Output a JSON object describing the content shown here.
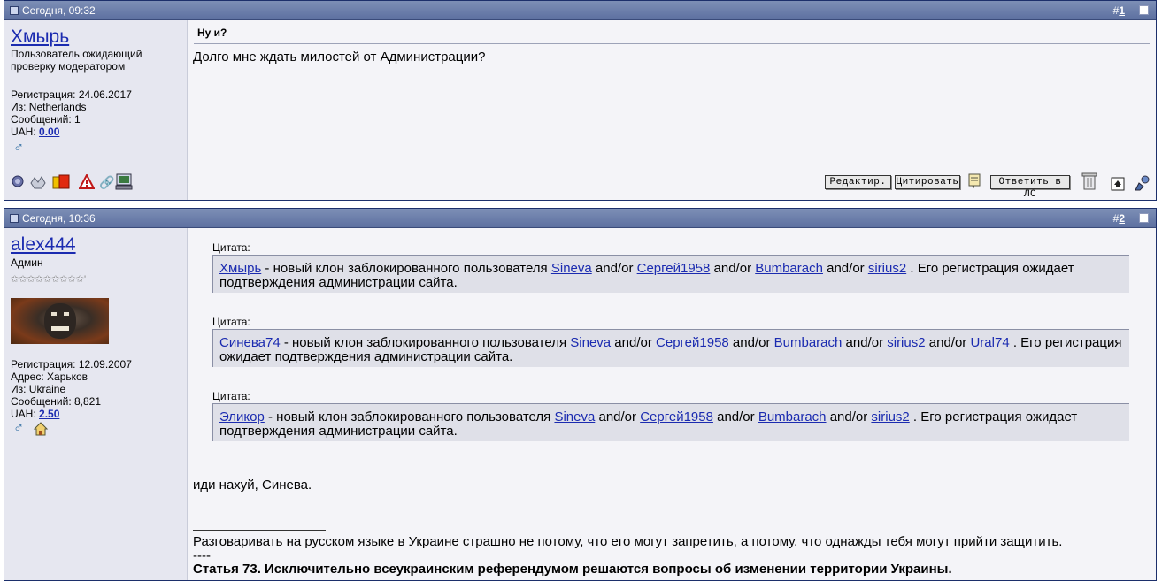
{
  "post1": {
    "date": "Сегодня, 09:32",
    "number_prefix": "#",
    "number": "1",
    "username": "Хмырь",
    "status": "Пользователь ожидающий проверку модератором",
    "reg": "Регистрация: 24.06.2017",
    "from": "Из: Netherlands",
    "posts": "Сообщений: 1",
    "uah_label": "UAH: ",
    "uah_value": "0.00",
    "title": "Ну и?",
    "message": "Долго мне ждать милостей от Администрации?",
    "buttons": {
      "edit": "Редактир.",
      "quote": "Цитировать",
      "reply_pm": "Ответить в ЛС"
    },
    "icons": [
      "offline-icon",
      "reputation-icon",
      "warning-card-icon",
      "report-icon",
      "attach-icon",
      "ip-icon",
      "note-icon",
      "delete-icon",
      "quick-reply-icon",
      "multi-quote-icon"
    ]
  },
  "post2": {
    "date": "Сегодня, 10:36",
    "number_prefix": "#",
    "number": "2",
    "username": "alex444",
    "role": "Админ",
    "stars": "✩✩✩✩✩✩✩✩✩'",
    "reg": "Регистрация: 12.09.2007",
    "address": "Адрес: Харьков",
    "from": "Из: Ukraine",
    "posts": "Сообщений: 8,821",
    "uah_label": "UAH: ",
    "uah_value": "2.50",
    "quote_label": "Цитата:",
    "quotes": [
      {
        "lead": "Хмырь",
        "text1": " - новый клон заблокированного пользователя ",
        "l1": "Sineva",
        "and": " and/or ",
        "l2": "Сергей1958",
        "l3": "Bumbarach",
        "l4": "sirius2",
        "tail": " . Его регистрация ожидает",
        "line2": "подтверждения администрации сайта."
      },
      {
        "lead": "Синева74",
        "text1": " - новый клон заблокированного пользователя ",
        "l1": "Sineva",
        "and": " and/or ",
        "l2": "Сергей1958",
        "l3": "Bumbarach",
        "l4": "sirius2",
        "l5": "Ural74",
        "tail": " . Его регистрация",
        "line2": "ожидает подтверждения администрации сайта."
      },
      {
        "lead": "Эликор",
        "text1": " - новый клон заблокированного пользователя ",
        "l1": "Sineva",
        "and": " and/or ",
        "l2": "Сергей1958",
        "l3": "Bumbarach",
        "l4": "sirius2",
        "tail": " . Его регистрация ожидает",
        "line2": "подтверждения администрации сайта."
      }
    ],
    "message": "иди нахуй, Синева.",
    "signature": "Разговаривать на русском языке в Украине страшно не потому, что его могут запретить, а потому, что однажды тебя могут прийти защитить.",
    "sig_sep": "----",
    "sig_bold": "Статья 73. Исключительно всеукраинским референдумом решаются вопросы об изменении территории Украины."
  }
}
